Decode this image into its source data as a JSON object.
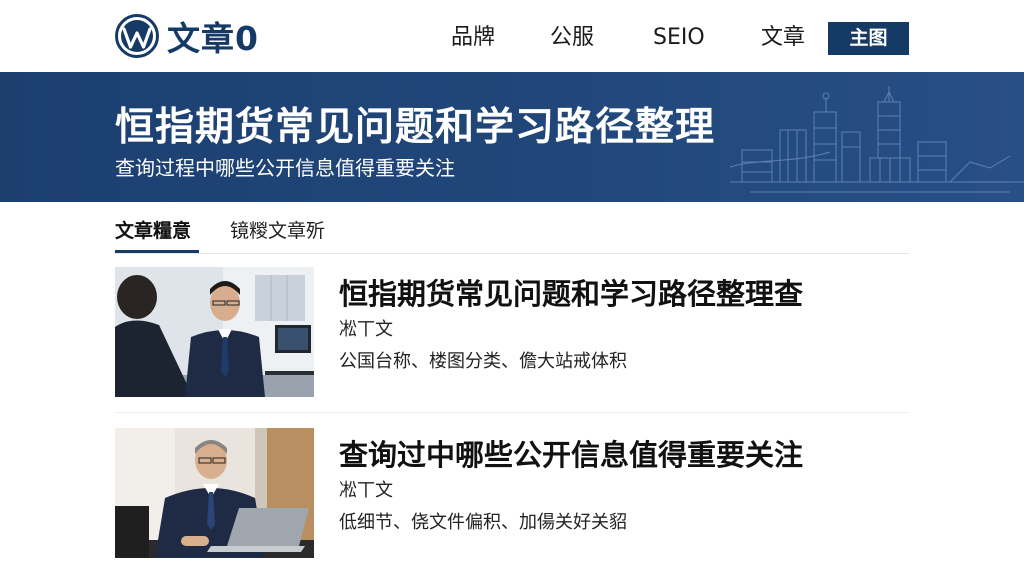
{
  "header": {
    "logo_text": "文章0",
    "nav": [
      {
        "label": "品牌"
      },
      {
        "label": "公服"
      },
      {
        "label": "SEIO"
      },
      {
        "label": "文章"
      }
    ],
    "primary_button": "主图"
  },
  "banner": {
    "title": "恒指期货常见问题和学习路径整理",
    "subtitle": "查询过程中哪些公开信息值得重要关注"
  },
  "tabs": [
    {
      "label": "文章糧意",
      "active": true
    },
    {
      "label": "镜糉文章歽",
      "active": false
    }
  ],
  "articles": [
    {
      "title": "恒指期货常见问题和学习路径整理查",
      "author": "凇丅文",
      "description": "公国台称、楼图分类、儋大站戒体积"
    },
    {
      "title": "查询过中哪些公开信息值得重要关注",
      "author": "凇丅文",
      "description": "低细节、侥文件偏积、加偒关好关貂"
    }
  ],
  "colors": {
    "brand": "#163a66",
    "banner": "#1f4475"
  }
}
